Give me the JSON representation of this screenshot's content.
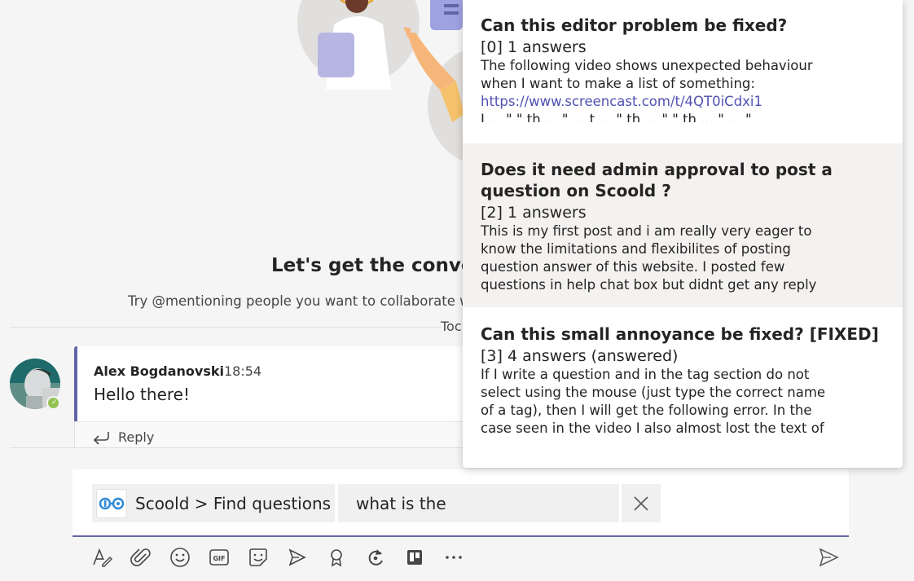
{
  "conversation": {
    "empty_title": "Let's get the conve",
    "empty_subtitle": "Try @mentioning people you want to collaborate wi",
    "date_divider": "Toc"
  },
  "message": {
    "author": "Alex Bogdanovski",
    "time": "18:54",
    "text": "Hello there!",
    "reply_label": "Reply",
    "presence": "available"
  },
  "compose": {
    "app_breadcrumb": "Scoold > Find questions",
    "search_value": "what is the",
    "toolbar": [
      "format-icon",
      "attach-icon",
      "emoji-icon",
      "gif-icon",
      "sticker-icon",
      "meet-icon",
      "praise-icon",
      "loop-icon",
      "trello-icon",
      "more-icon",
      "send-icon"
    ]
  },
  "results": [
    {
      "title": "Can this editor problem be fixed?",
      "meta": "[0] 1 answers",
      "desc": "The following video shows unexpected behaviour when I want to make a list of something:",
      "link": "https://www.screencast.com/t/4QT0iCdxi1",
      "desc_tail": "I ... \" \" th ... \" ... t ... \" th ... \" \" th ... \" ... \""
    },
    {
      "title": "Does it need admin approval to post a question on Scoold ?",
      "meta": "[2] 1 answers",
      "desc": "This is my first post and i am really very eager to know the limitations and flexibilites of posting question answer of this website. I posted few questions in help chat box but didnt get any reply s..."
    },
    {
      "title": "Can this small annoyance be fixed? [FIXED]",
      "meta": "[3] 4 answers (answered)",
      "desc": "If I write a question and in the tag section do not select using the mouse (just type the correct name of a tag), then I will get the following error. In the case seen in the video I also almost lost the text of the..."
    }
  ],
  "colors": {
    "accent": "#6264a7",
    "presence": "#92c353",
    "link": "#4f52b2"
  }
}
